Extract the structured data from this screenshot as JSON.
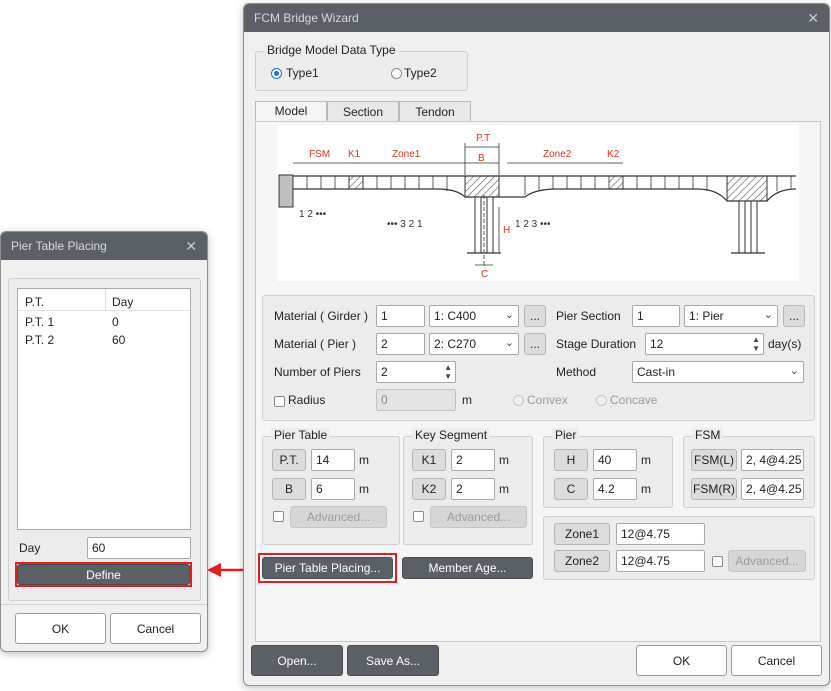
{
  "pier_table_dialog": {
    "title": "Pier Table Placing",
    "columns": [
      "P.T.",
      "Day"
    ],
    "rows": [
      {
        "pt": "P.T. 1",
        "day": "0"
      },
      {
        "pt": "P.T. 2",
        "day": "60"
      }
    ],
    "day_label": "Day",
    "day_value": "60",
    "define_label": "Define",
    "ok_label": "OK",
    "cancel_label": "Cancel"
  },
  "wizard": {
    "title": "FCM Bridge Wizard",
    "data_type": {
      "title": "Bridge Model Data Type",
      "type1": "Type1",
      "type2": "Type2",
      "selected": "Type1"
    },
    "tabs": [
      "Model",
      "Section",
      "Tendon"
    ],
    "active_tab": "Model",
    "diagram": {
      "fsm": "FSM",
      "k1": "K1",
      "zone1": "Zone1",
      "pt": "P.T",
      "b": "B",
      "zone2": "Zone2",
      "k2": "K2",
      "h": "H",
      "c": "C",
      "left_seq": "1   2  •••",
      "mid_left_seq": "•••  3   2   1",
      "mid_right_seq": "1   2   3  •••"
    },
    "material": {
      "girder_label": "Material ( Girder )",
      "girder_num": "1",
      "girder_value": "1: C400",
      "pier_label": "Material ( Pier )",
      "pier_num": "2",
      "pier_value": "2: C270",
      "num_piers_label": "Number of Piers",
      "num_piers": "2",
      "radius_label": "Radius",
      "radius_value": "0",
      "radius_unit": "m",
      "convex": "Convex",
      "concave": "Concave",
      "pier_section_label": "Pier Section",
      "pier_section_num": "1",
      "pier_section_value": "1: Pier",
      "stage_duration_label": "Stage Duration",
      "stage_duration": "12",
      "stage_unit": "day(s)",
      "method_label": "Method",
      "method_value": "Cast-in",
      "browse": "..."
    },
    "pier_table": {
      "title": "Pier Table",
      "pt_label": "P.T.",
      "pt_value": "14",
      "b_label": "B",
      "b_value": "6",
      "unit": "m",
      "advanced": "Advanced..."
    },
    "key_segment": {
      "title": "Key Segment",
      "k1_label": "K1",
      "k1_value": "2",
      "k2_label": "K2",
      "k2_value": "2",
      "unit": "m",
      "advanced": "Advanced..."
    },
    "pier": {
      "title": "Pier",
      "h_label": "H",
      "h_value": "40",
      "c_label": "C",
      "c_value": "4.2",
      "unit": "m"
    },
    "fsm": {
      "title": "FSM",
      "fsml_label": "FSM(L)",
      "fsml_value": "2, 4@4.25",
      "fsmr_label": "FSM(R)",
      "fsmr_value": "2, 4@4.25"
    },
    "zones": {
      "zone1_label": "Zone1",
      "zone1_value": "12@4.75",
      "zone2_label": "Zone2",
      "zone2_value": "12@4.75",
      "advanced": "Advanced..."
    },
    "pier_table_placing_label": "Pier Table Placing...",
    "member_age_label": "Member Age...",
    "open_label": "Open...",
    "save_as_label": "Save As...",
    "ok_label": "OK",
    "cancel_label": "Cancel"
  },
  "colors": {
    "titlebar": "#5b6066",
    "highlight_red": "#e02020",
    "accent_blue": "#1e6fd9"
  }
}
